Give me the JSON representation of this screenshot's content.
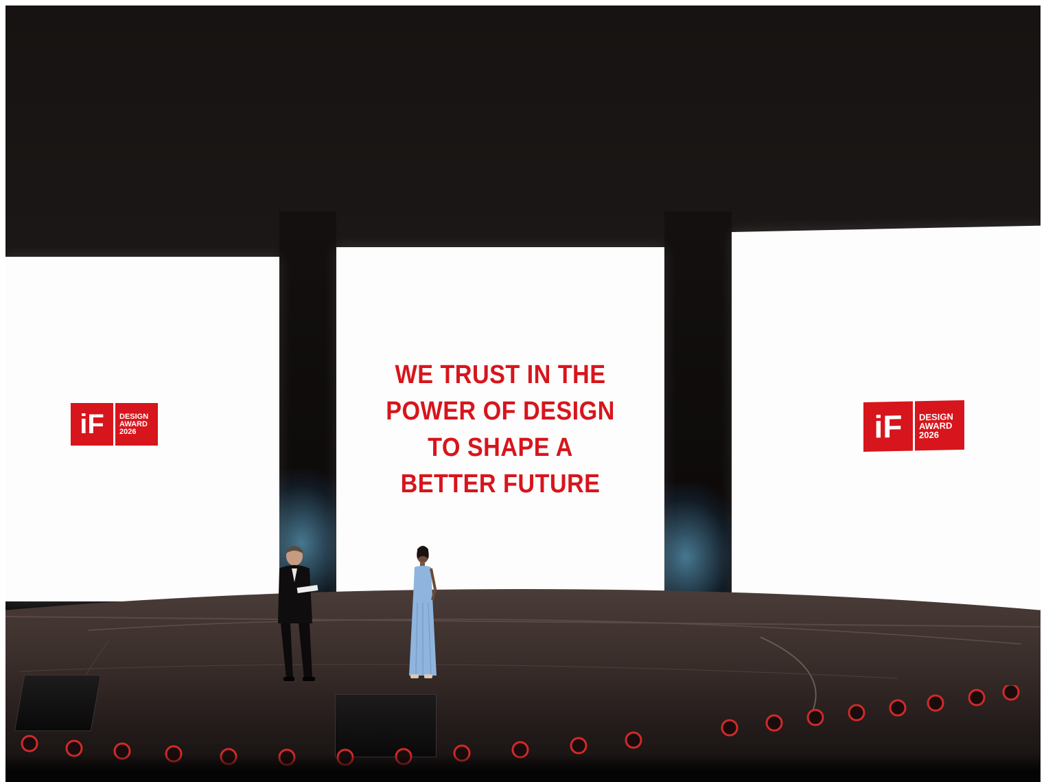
{
  "center_screen": {
    "motto_lines": [
      "WE TRUST IN THE",
      "POWER OF DESIGN",
      "TO SHAPE A",
      "BETTER FUTURE"
    ]
  },
  "logo": {
    "mark": "iF",
    "lines": [
      "DESIGN",
      "AWARD",
      "2026"
    ]
  },
  "colors": {
    "brand_red": "#d7151c",
    "screen_white": "#fdfdfd",
    "backdrop": "#171312",
    "dress_blue": "#8fb5de"
  }
}
